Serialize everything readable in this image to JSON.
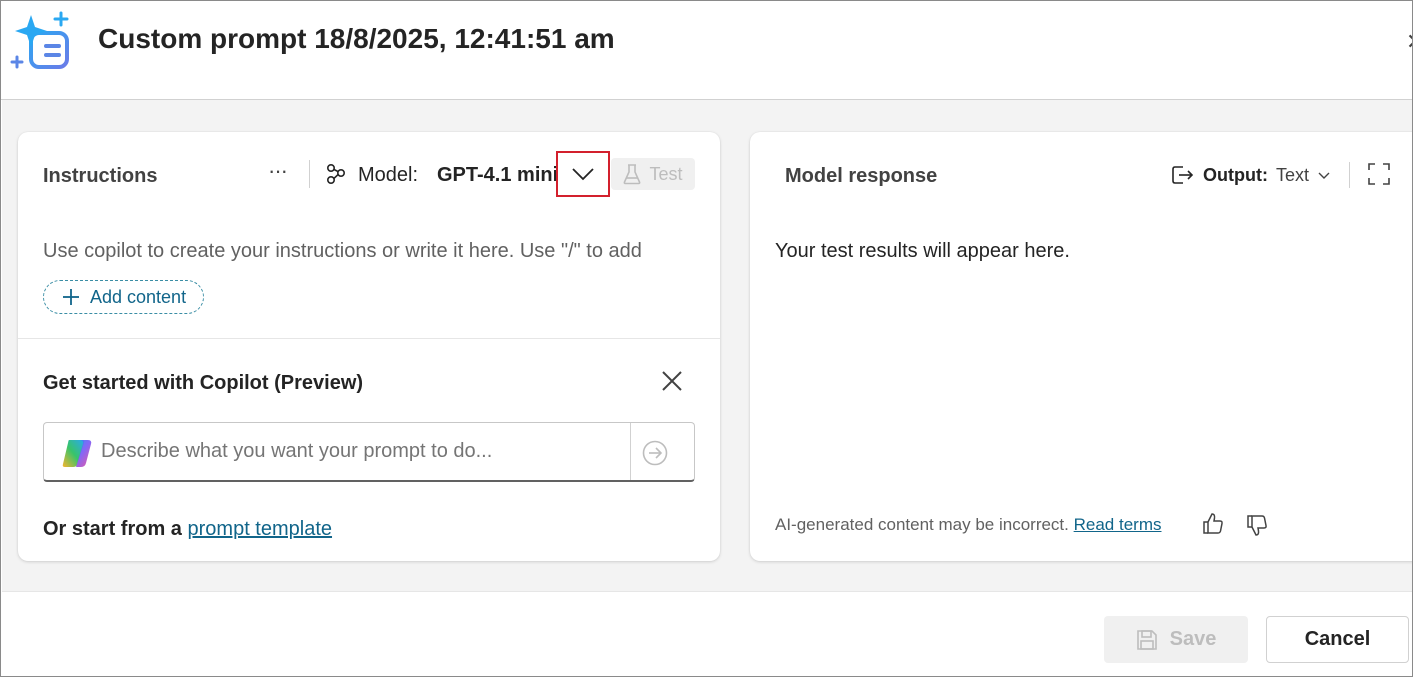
{
  "header": {
    "title": "Custom prompt 18/8/2025, 12:41:51 am",
    "app_icon": "sparkle-document-icon",
    "close_icon": "close-icon"
  },
  "instructions": {
    "title": "Instructions",
    "more_label": "···",
    "model_label": "Model:",
    "model_value": "GPT-4.1 mini",
    "test_label": "Test",
    "hint": "Use copilot to create your instructions or write it here. Use \"/\" to add",
    "add_content_label": "Add content"
  },
  "copilot": {
    "title": "Get started with Copilot (Preview)",
    "placeholder": "Describe what you want your prompt to do...",
    "start_from_prefix": "Or start from a",
    "template_link": "prompt template"
  },
  "response": {
    "title": "Model response",
    "output_label": "Output:",
    "output_value": "Text",
    "placeholder_text": "Your test results will appear here.",
    "disclaimer": "AI-generated content may be incorrect.",
    "read_terms": "Read terms"
  },
  "footer": {
    "save_label": "Save",
    "cancel_label": "Cancel"
  },
  "colors": {
    "accent": "#11658a",
    "highlight_box": "#d3202d",
    "disabled_text": "#bdbdbd"
  }
}
